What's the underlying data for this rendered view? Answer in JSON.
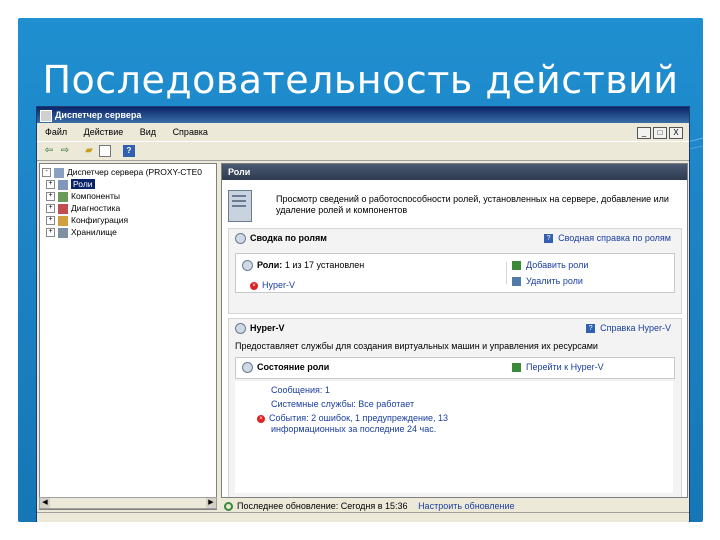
{
  "slide": {
    "title": "Последовательность действий"
  },
  "window": {
    "title": "Диспетчер сервера",
    "menu": [
      "Файл",
      "Действие",
      "Вид",
      "Справка"
    ],
    "controls": [
      "_",
      "□",
      "X"
    ]
  },
  "tree": {
    "root": "Диспетчер сервера (PROXY-CTE0",
    "items": [
      "Роли",
      "Компоненты",
      "Диагностика",
      "Конфигурация",
      "Хранилище"
    ]
  },
  "roles_panel": {
    "header": "Роли",
    "description": "Просмотр сведений о работоспособности ролей, установленных на сервере, добавление или удаление ролей и компонентов",
    "summary": {
      "title": "Сводка по ролям",
      "help": "Сводная справка по ролям",
      "roles_label": "Роли:",
      "roles_value": "1 из 17 установлен",
      "role_item": "Hyper-V",
      "add_roles": "Добавить роли",
      "remove_roles": "Удалить роли"
    },
    "hyperv": {
      "title": "Hyper-V",
      "help": "Справка Hyper-V",
      "description": "Предоставляет службы для создания виртуальных машин и управления их ресурсами",
      "role_status": "Состояние роли",
      "goto": "Перейти к Hyper-V",
      "messages": "Сообщения: 1",
      "services": "Системные службы: Все работает",
      "events_line1": "События: 2 ошибок, 1 предупреждение, 13",
      "events_line2": "информационных за последние 24 час."
    }
  },
  "status": {
    "last_update": "Последнее обновление: Сегодня в 15:36",
    "configure": "Настроить обновление"
  },
  "colors": {
    "slide_bg": "#1d84c6",
    "titlebar": "#0a246a",
    "link": "#1a3ea0"
  },
  "icons": [
    "back-icon",
    "forward-icon",
    "folder-icon",
    "properties-icon",
    "help-icon",
    "server-icon",
    "error-icon",
    "add-roles-icon",
    "remove-roles-icon",
    "hyperv-goto-icon",
    "refresh-icon"
  ]
}
